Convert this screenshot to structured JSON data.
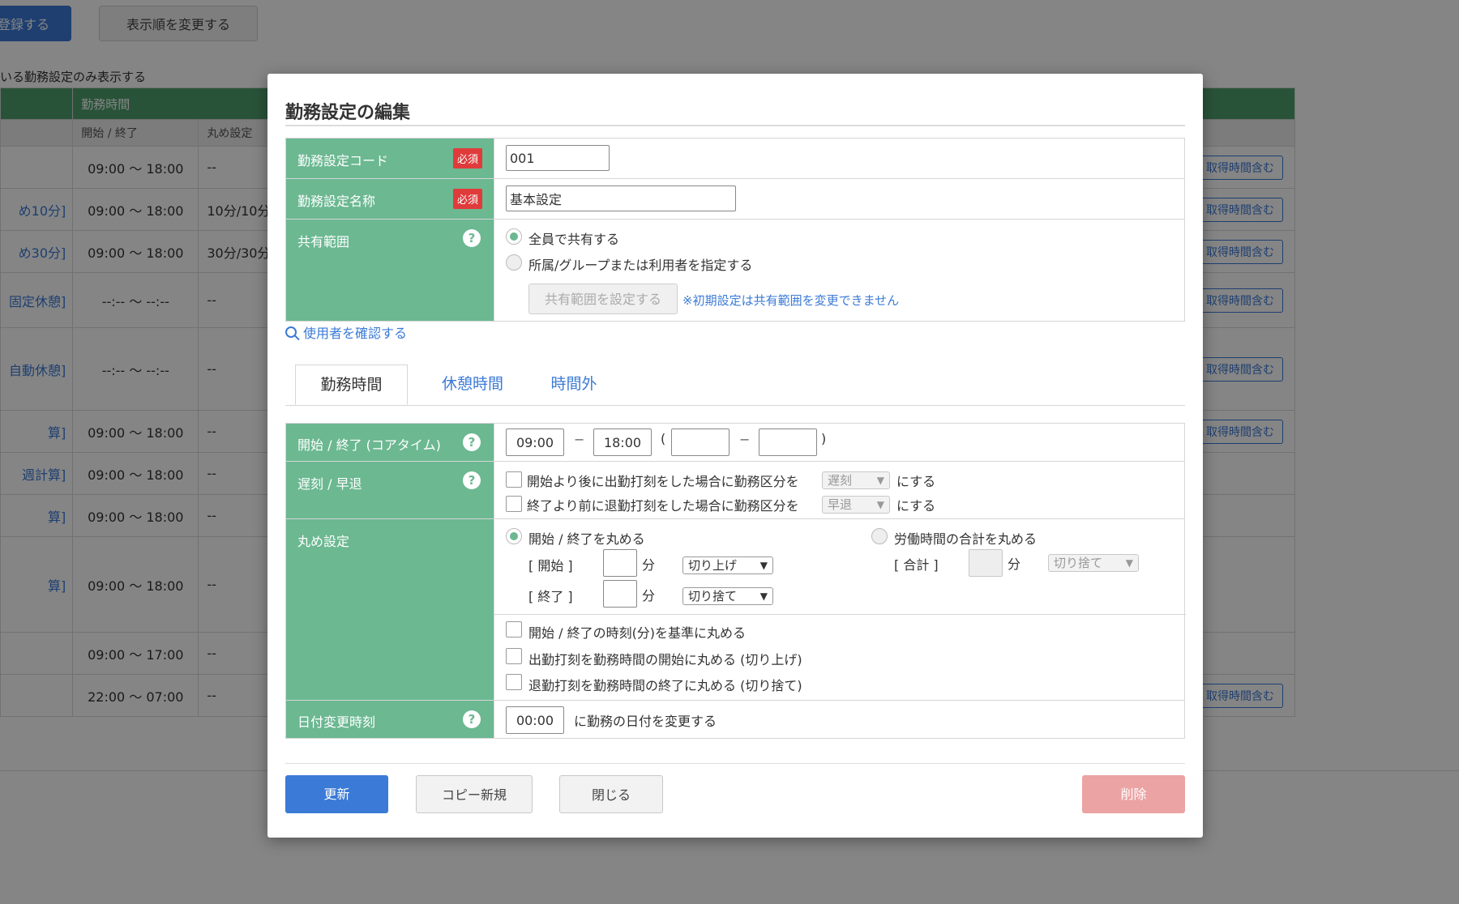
{
  "background": {
    "register_button": "登録する",
    "reorder_button": "表示順を変更する",
    "filter_text": "いる勤務設定のみ表示する",
    "header_group": "勤務時間",
    "col_start_end": "開始 / 終了",
    "col_rounding": "丸め設定",
    "rows": [
      {
        "name": "",
        "time": "09:00 〜 18:00",
        "rounding": "--",
        "tag": "取得時間含む"
      },
      {
        "name": "め10分]",
        "time": "09:00 〜 18:00",
        "rounding": "10分/10分",
        "tag": "取得時間含む"
      },
      {
        "name": "め30分]",
        "time": "09:00 〜 18:00",
        "rounding": "30分/30分",
        "tag": "取得時間含む"
      },
      {
        "name": "固定休憩]",
        "time": "--:-- 〜 --:--",
        "rounding": "--",
        "tag": "取得時間含む"
      },
      {
        "name": "自動休憩]",
        "time": "--:-- 〜 --:--",
        "rounding": "--",
        "tag": "取得時間含む"
      },
      {
        "name": "算]",
        "time": "09:00 〜 18:00",
        "rounding": "--",
        "tag": "取得時間含む"
      },
      {
        "name": "週計算]",
        "time": "09:00 〜 18:00",
        "rounding": "--",
        "tag": ""
      },
      {
        "name": "算]",
        "time": "09:00 〜 18:00",
        "rounding": "--",
        "tag": ""
      },
      {
        "name": "算]",
        "time": "09:00 〜 18:00",
        "rounding": "--",
        "tag": ""
      },
      {
        "name": "",
        "time": "09:00 〜 17:00",
        "rounding": "--",
        "tag": ""
      },
      {
        "name": "",
        "time": "22:00 〜 07:00",
        "rounding": "--",
        "tag": "取得時間含む"
      }
    ]
  },
  "modal": {
    "title": "勤務設定の編集",
    "required_badge": "必須",
    "code": {
      "label": "勤務設定コード",
      "value": "001"
    },
    "name": {
      "label": "勤務設定名称",
      "value": "基本設定"
    },
    "share": {
      "label": "共有範囲",
      "option_all": "全員で共有する",
      "option_specify": "所属/グループまたは利用者を指定する",
      "set_button": "共有範囲を設定する",
      "note": "※初期設定は共有範囲を変更できません"
    },
    "check_users_link": "使用者を確認する",
    "tabs": [
      "勤務時間",
      "休憩時間",
      "時間外"
    ],
    "core_time": {
      "label": "開始 / 終了 (コアタイム)",
      "start": "09:00",
      "end": "18:00",
      "dash": "−",
      "open_paren": "(",
      "close_paren": ")",
      "core_start": "",
      "core_end": ""
    },
    "late_early": {
      "label": "遅刻 / 早退",
      "late_text": "開始より後に出勤打刻をした場合に勤務区分を",
      "late_select": "遅刻",
      "early_text": "終了より前に退勤打刻をした場合に勤務区分を",
      "early_select": "早退",
      "suffix": "にする"
    },
    "rounding": {
      "label": "丸め設定",
      "option_start_end": "開始 / 終了を丸める",
      "start_label": "[ 開始 ]",
      "end_label": "[ 終了 ]",
      "minute_unit": "分",
      "start_minutes": "",
      "end_minutes": "",
      "start_select": "切り上げ",
      "end_select": "切り捨て",
      "option_total": "労働時間の合計を丸める",
      "total_label": "[ 合計 ]",
      "total_minutes": "",
      "total_select": "切り捨て",
      "check_minute_basis": "開始 / 終了の時刻(分)を基準に丸める",
      "check_clock_in": "出勤打刻を勤務時間の開始に丸める (切り上げ)",
      "check_clock_out": "退勤打刻を勤務時間の終了に丸める (切り捨て)"
    },
    "date_change": {
      "label": "日付変更時刻",
      "value": "00:00",
      "suffix": "に勤務の日付を変更する"
    },
    "buttons": {
      "update": "更新",
      "copy_new": "コピー新規",
      "close": "閉じる",
      "delete": "削除"
    }
  }
}
